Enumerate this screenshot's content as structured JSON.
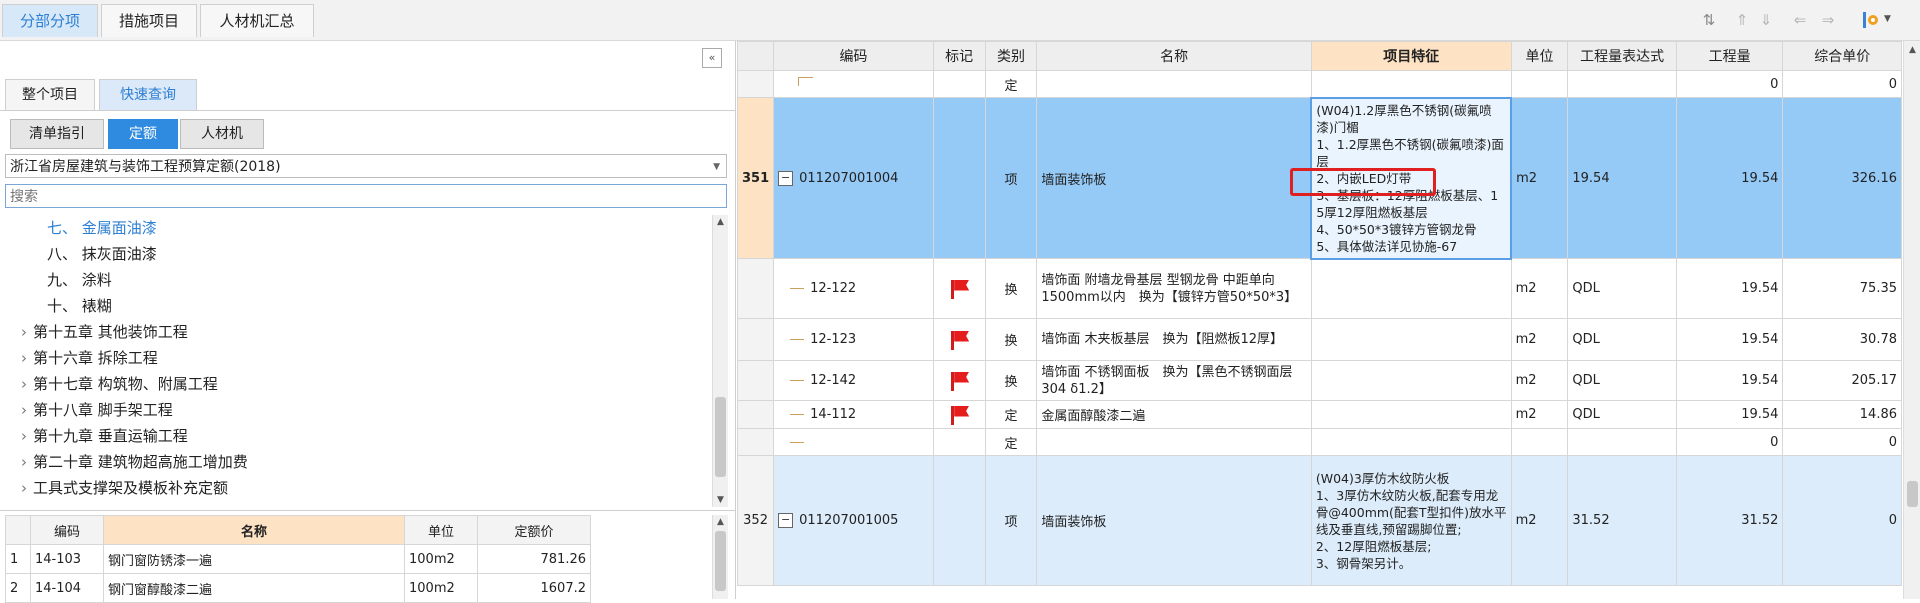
{
  "top_tabs": [
    "分部分项",
    "措施项目",
    "人材机汇总"
  ],
  "left": {
    "panel_tabs": [
      "整个项目",
      "快速查询"
    ],
    "sub_tabs": [
      "清单指引",
      "定额",
      "人材机"
    ],
    "quota_library": "浙江省房屋建筑与装饰工程预算定额(2018)",
    "search_placeholder": "搜索",
    "tree": [
      {
        "label": "七、 金属面油漆",
        "expandable": false,
        "selected": true
      },
      {
        "label": "八、 抹灰面油漆",
        "expandable": false
      },
      {
        "label": "九、 涂料",
        "expandable": false
      },
      {
        "label": "十、 裱糊",
        "expandable": false
      },
      {
        "label": "第十五章 其他装饰工程",
        "expandable": true
      },
      {
        "label": "第十六章 拆除工程",
        "expandable": true
      },
      {
        "label": "第十七章 构筑物、附属工程",
        "expandable": true
      },
      {
        "label": "第十八章 脚手架工程",
        "expandable": true
      },
      {
        "label": "第十九章 垂直运输工程",
        "expandable": true
      },
      {
        "label": "第二十章 建筑物超高施工增加费",
        "expandable": true
      },
      {
        "label": "工具式支撑架及模板补充定额",
        "expandable": true
      }
    ],
    "quota_table": {
      "headers": [
        "编码",
        "名称",
        "单位",
        "定额价"
      ],
      "rows": [
        {
          "no": "1",
          "code": "14-103",
          "name": "钢门窗防锈漆一遍",
          "unit": "100m2",
          "price": "781.26"
        },
        {
          "no": "2",
          "code": "14-104",
          "name": "钢门窗醇酸漆二遍",
          "unit": "100m2",
          "price": "1607.2"
        }
      ]
    }
  },
  "grid": {
    "headers": [
      "编码",
      "标记",
      "类别",
      "名称",
      "项目特征",
      "单位",
      "工程量表达式",
      "工程量",
      "综合单价"
    ],
    "rows": [
      {
        "kind": "sub",
        "no": "",
        "code": "",
        "flag": false,
        "type": "定",
        "name": "",
        "feature": "",
        "unit": "",
        "expr": "",
        "qty": "0",
        "price": "0"
      },
      {
        "kind": "item",
        "no": "351",
        "code": "011207001004",
        "flag": false,
        "type": "项",
        "name": "墙面装饰板",
        "feature": "(W04)1.2厚黑色不锈钢(碳氟喷漆)门楣\n1、1.2厚黑色不锈钢(碳氟喷漆)面层\n2、内嵌LED灯带\n3、基层板：12厚阻燃板基层、15厚12厚阻燃板基层\n4、50*50*3镀锌方管钢龙骨\n5、具体做法详见协施-67",
        "unit": "m2",
        "expr": "19.54",
        "qty": "19.54",
        "price": "326.16"
      },
      {
        "kind": "sub",
        "no": "",
        "code": "12-122",
        "flag": true,
        "type": "换",
        "name": "墙饰面 附墙龙骨基层 型钢龙骨 中距单向1500mm以内　换为【镀锌方管50*50*3】",
        "feature": "",
        "unit": "m2",
        "expr": "QDL",
        "qty": "19.54",
        "price": "75.35"
      },
      {
        "kind": "sub",
        "no": "",
        "code": "12-123",
        "flag": true,
        "type": "换",
        "name": "墙饰面 木夹板基层　换为【阻燃板12厚】",
        "feature": "",
        "unit": "m2",
        "expr": "QDL",
        "qty": "19.54",
        "price": "30.78"
      },
      {
        "kind": "sub",
        "no": "",
        "code": "12-142",
        "flag": true,
        "type": "换",
        "name": "墙饰面 不锈钢面板　换为【黑色不锈钢面层304 δ1.2】",
        "feature": "",
        "unit": "m2",
        "expr": "QDL",
        "qty": "19.54",
        "price": "205.17"
      },
      {
        "kind": "sub",
        "no": "",
        "code": "14-112",
        "flag": true,
        "type": "定",
        "name": "金属面醇酸漆二遍",
        "feature": "",
        "unit": "m2",
        "expr": "QDL",
        "qty": "19.54",
        "price": "14.86"
      },
      {
        "kind": "sub",
        "no": "",
        "code": "",
        "flag": false,
        "type": "定",
        "name": "",
        "feature": "",
        "unit": "",
        "expr": "",
        "qty": "0",
        "price": "0"
      },
      {
        "kind": "item",
        "no": "352",
        "code": "011207001005",
        "flag": false,
        "type": "项",
        "name": "墙面装饰板",
        "feature": "(W04)3厚仿木纹防火板\n1、3厚仿木纹防火板,配套专用龙骨@400mm(配套T型扣件)放水平线及垂直线,预留踢脚位置;\n2、12厚阻燃板基层;\n3、钢骨架另计。",
        "unit": "m2",
        "expr": "31.52",
        "qty": "31.52",
        "price": "0"
      }
    ]
  },
  "colors": {
    "accent": "#2d7fd3",
    "selected_row": "#95c9f6",
    "feature_header": "#fde3c4",
    "highlight_box": "#e02020",
    "flag": "#e51d1d"
  }
}
